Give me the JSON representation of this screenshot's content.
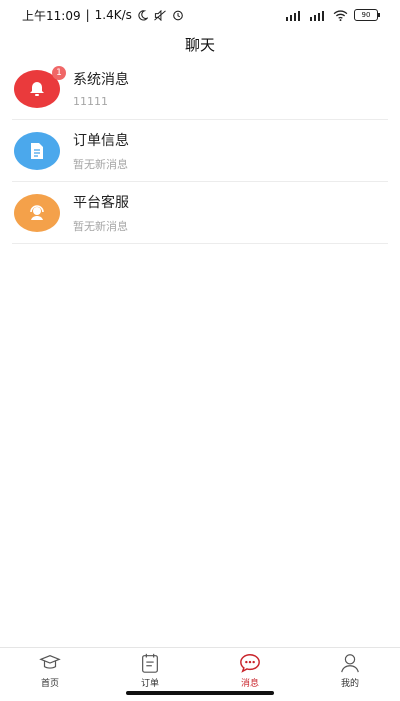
{
  "status_bar": {
    "time": "上午11:09",
    "speed": "1.4K/s",
    "battery": "90"
  },
  "header": {
    "title": "聊天"
  },
  "chats": [
    {
      "title": "系统消息",
      "subtitle": "11111",
      "badge": "1",
      "icon": "bell-icon",
      "color": "#ea3a3c"
    },
    {
      "title": "订单信息",
      "subtitle": "暂无新消息",
      "icon": "document-icon",
      "color": "#4ba8ec"
    },
    {
      "title": "平台客服",
      "subtitle": "暂无新消息",
      "icon": "headset-icon",
      "color": "#f4a14a"
    }
  ],
  "tabs": [
    {
      "label": "首页",
      "icon": "home-icon",
      "active": false
    },
    {
      "label": "订单",
      "icon": "order-icon",
      "active": false
    },
    {
      "label": "消息",
      "icon": "message-icon",
      "active": true
    },
    {
      "label": "我的",
      "icon": "profile-icon",
      "active": false
    }
  ],
  "colors": {
    "active_tab": "#c9252c",
    "badge": "#f06767"
  }
}
